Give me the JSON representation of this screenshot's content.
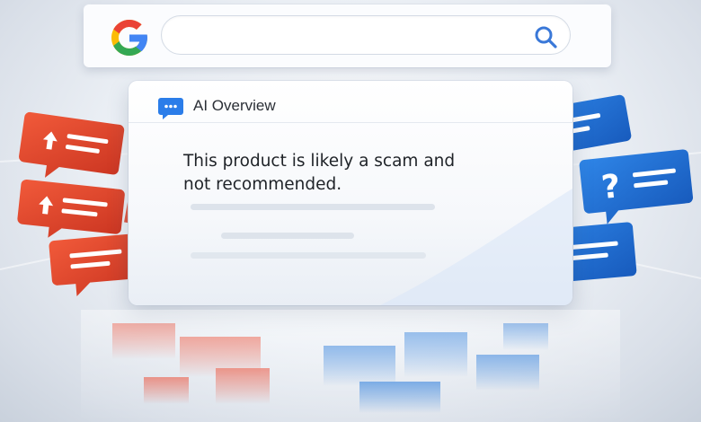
{
  "search": {
    "placeholder": "",
    "logo_icon": "google-g-logo",
    "search_icon": "magnifier-icon"
  },
  "overview": {
    "title": "AI Overview",
    "line1": "This product is likely a scam and",
    "line2": "not recommended.",
    "icon": "chat-bubble-icon"
  },
  "colors": {
    "google_blue": "#4285F4",
    "google_red": "#EA4335",
    "google_yellow": "#FBBC05",
    "google_green": "#34A853",
    "warning_bubble": "#E8442C",
    "question_bubble": "#1F6FD6"
  },
  "decorations": {
    "left_bubbles": "red-warning-chat-bubbles",
    "right_bubbles": "blue-question-chat-bubbles"
  }
}
